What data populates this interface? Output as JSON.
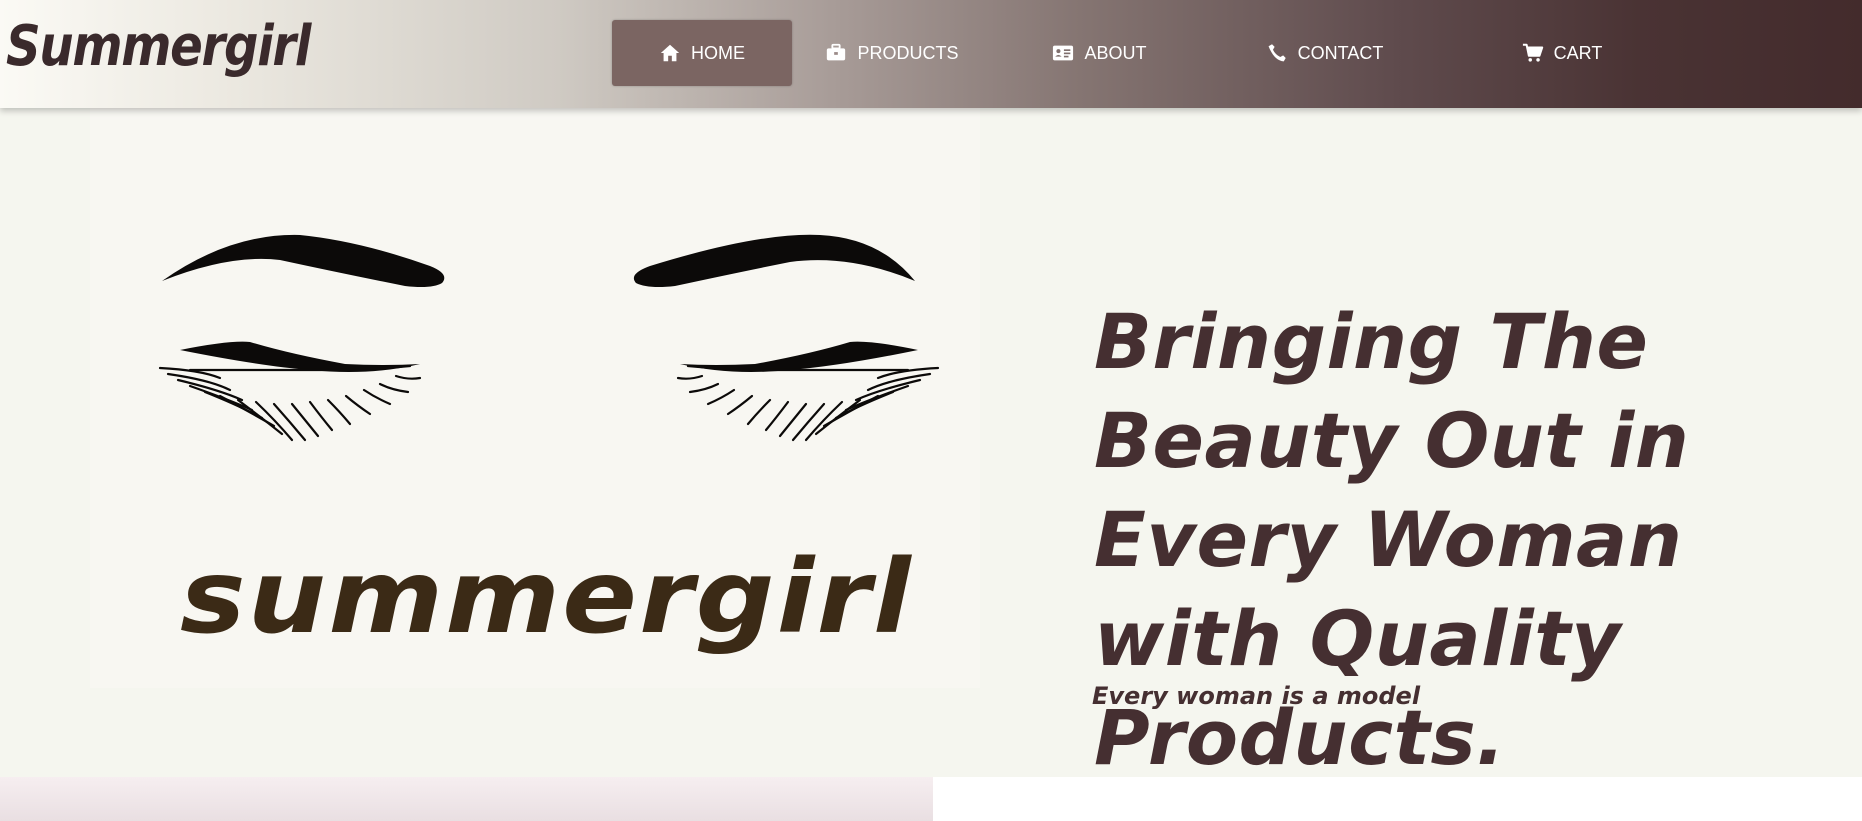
{
  "brand": {
    "name": "Summergirl"
  },
  "nav": {
    "items": [
      {
        "label": "HOME",
        "icon": "home-icon",
        "active": true
      },
      {
        "label": "PRODUCTS",
        "icon": "briefcase-icon",
        "active": false
      },
      {
        "label": "ABOUT",
        "icon": "id-card-icon",
        "active": false
      },
      {
        "label": "CONTACT",
        "icon": "phone-icon",
        "active": false
      },
      {
        "label": "CART",
        "icon": "cart-icon",
        "active": false
      }
    ]
  },
  "hero": {
    "logo_wordmark": "summergirl",
    "headline": "Bringing The Beauty Out in Every Woman with Quality Products.",
    "tagline": "Every woman is a model"
  },
  "colors": {
    "brand_dark": "#452f31",
    "nav_active": "#7b6562",
    "logo_brown": "#3b2a16",
    "page_bg": "#f5f6ef"
  }
}
